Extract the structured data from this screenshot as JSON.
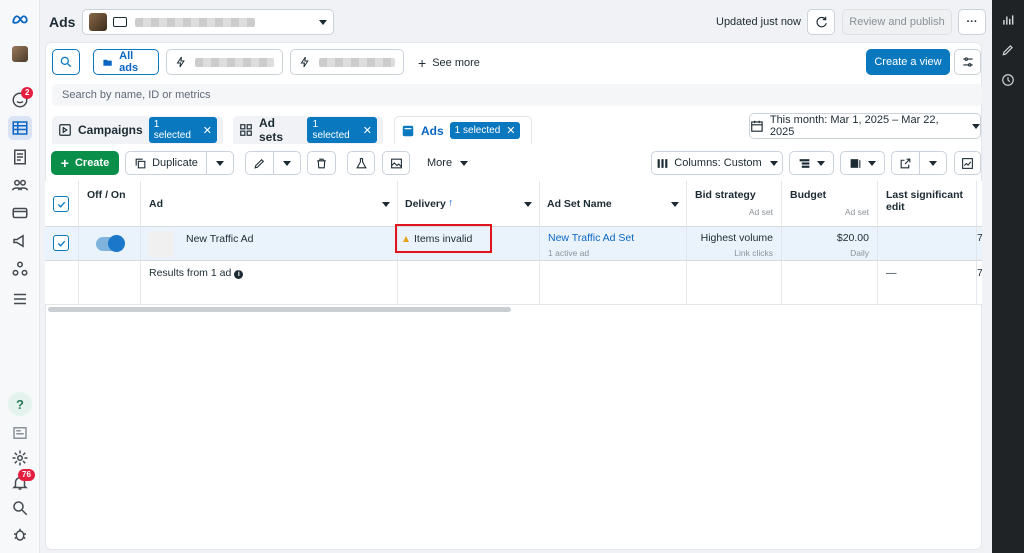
{
  "app": {
    "title": "Ads"
  },
  "header": {
    "updated_text": "Updated just now",
    "review_button": "Review and publish",
    "more_button": "···"
  },
  "filters": {
    "all_ads": "All ads",
    "see_more": "See more",
    "create_view": "Create a view",
    "search_placeholder": "Search by name, ID or metrics"
  },
  "tabs": [
    {
      "label": "Campaigns",
      "badge": "1 selected"
    },
    {
      "label": "Ad sets",
      "badge": "1 selected"
    },
    {
      "label": "Ads",
      "badge": "1 selected"
    }
  ],
  "date_range": "This month: Mar 1, 2025 – Mar 22, 2025",
  "toolbar": {
    "create": "Create",
    "duplicate": "Duplicate",
    "more": "More",
    "columns": "Columns: Custom"
  },
  "table": {
    "headers": {
      "off_on": "Off / On",
      "ad": "Ad",
      "delivery": "Delivery",
      "delivery_sort": "↑",
      "ad_set_name": "Ad Set Name",
      "bid_strategy": "Bid strategy",
      "bid_strategy_sub": "Ad set",
      "budget": "Budget",
      "budget_sub": "Ad set",
      "last_edit": "Last significant edit"
    },
    "row": {
      "ad_name": "New Traffic Ad",
      "delivery": "Items invalid",
      "ad_set_name": "New Traffic Ad Set",
      "ad_set_sub": "1 active ad",
      "bid_strategy": "Highest volume",
      "bid_strategy_sub": "Link clicks",
      "budget": "$20.00",
      "budget_sub": "Daily",
      "next_col": "7"
    },
    "summary": {
      "label": "Results from 1 ad",
      "last_edit": "—",
      "next_col": "7"
    }
  },
  "nav": {
    "notifications_badge": "2",
    "alerts_badge": "76",
    "help": "?"
  },
  "colors": {
    "accent": "#0a78be",
    "create_green": "#0a8f4a",
    "highlight": "#e0141e"
  }
}
